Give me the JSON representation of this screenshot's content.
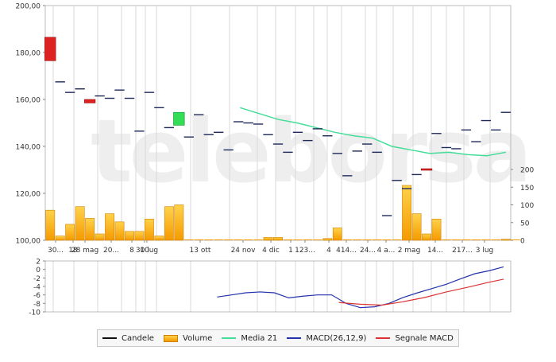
{
  "colors": {
    "candle_up": "#33dd55",
    "candle_down": "#dd2222",
    "doji": "#1f2a5a",
    "volume_fill_top": "#ffd24a",
    "volume_fill_bottom": "#f59a00",
    "media21": "#44dd99",
    "macd": "#2233aa",
    "signal": "#dd3333",
    "grid": "#d8d8d8",
    "watermark": "#eeeeee"
  },
  "watermark": "teleborsa",
  "legend": [
    {
      "key": "candele",
      "label": "Candele",
      "icon": "black-line"
    },
    {
      "key": "volume",
      "label": "Volume",
      "icon": "orange-box"
    },
    {
      "key": "media21",
      "label": "Media 21",
      "icon": "green-line"
    },
    {
      "key": "macd",
      "label": "MACD(26,12,9)",
      "icon": "blue-line"
    },
    {
      "key": "signal",
      "label": "Segnale MACD",
      "icon": "red-line"
    }
  ],
  "chart_data": [
    {
      "type": "candlestick",
      "y_ticks": [
        "100,00",
        "120,00",
        "140,00",
        "160,00",
        "180,00",
        "200,00"
      ],
      "ylim": [
        100,
        200
      ],
      "volume_y_ticks": [
        "0",
        "50",
        "100",
        "150",
        "200"
      ],
      "volume_ylim": [
        0,
        200
      ],
      "x_labels": [
        "30...",
        "28 mag",
        "18",
        "20...",
        "8",
        "30 lug",
        "10",
        "13 ott",
        "24 nov",
        "4 dic",
        "1",
        "123...",
        "4",
        "414...",
        "24...",
        "4 a...",
        "2 mag",
        "14...",
        "217...",
        "3 lug"
      ],
      "candles": [
        {
          "o": 176.5,
          "c": 186.5,
          "dir": "down"
        },
        {
          "o": 167.5,
          "c": 167.5,
          "dir": "flat"
        },
        {
          "o": 163.0,
          "c": 163.0,
          "dir": "flat"
        },
        {
          "o": 164.5,
          "c": 164.5,
          "dir": "flat"
        },
        {
          "o": 158.5,
          "c": 160.0,
          "dir": "down"
        },
        {
          "o": 161.5,
          "c": 161.5,
          "dir": "flat"
        },
        {
          "o": 160.5,
          "c": 160.5,
          "dir": "flat"
        },
        {
          "o": 164.0,
          "c": 164.0,
          "dir": "flat"
        },
        {
          "o": 160.5,
          "c": 160.5,
          "dir": "flat"
        },
        {
          "o": 146.5,
          "c": 146.5,
          "dir": "flat"
        },
        {
          "o": 163.0,
          "c": 163.0,
          "dir": "flat"
        },
        {
          "o": 156.5,
          "c": 156.5,
          "dir": "flat"
        },
        {
          "o": 148.0,
          "c": 148.0,
          "dir": "flat"
        },
        {
          "o": 149.0,
          "c": 154.5,
          "dir": "up"
        },
        {
          "o": 144.0,
          "c": 144.0,
          "dir": "flat"
        },
        {
          "o": 153.5,
          "c": 153.5,
          "dir": "flat"
        },
        {
          "o": 145.0,
          "c": 145.0,
          "dir": "flat"
        },
        {
          "o": 146.0,
          "c": 146.0,
          "dir": "flat"
        },
        {
          "o": 138.5,
          "c": 138.5,
          "dir": "flat"
        },
        {
          "o": 150.5,
          "c": 150.5,
          "dir": "flat"
        },
        {
          "o": 150.0,
          "c": 150.0,
          "dir": "flat"
        },
        {
          "o": 149.5,
          "c": 149.5,
          "dir": "flat"
        },
        {
          "o": 145.0,
          "c": 145.0,
          "dir": "flat"
        },
        {
          "o": 141.0,
          "c": 141.0,
          "dir": "flat"
        },
        {
          "o": 137.5,
          "c": 137.5,
          "dir": "flat"
        },
        {
          "o": 146.0,
          "c": 146.0,
          "dir": "flat"
        },
        {
          "o": 142.5,
          "c": 142.5,
          "dir": "flat"
        },
        {
          "o": 147.5,
          "c": 147.5,
          "dir": "flat"
        },
        {
          "o": 144.5,
          "c": 144.5,
          "dir": "flat"
        },
        {
          "o": 137.0,
          "c": 137.0,
          "dir": "flat"
        },
        {
          "o": 127.5,
          "c": 127.5,
          "dir": "flat"
        },
        {
          "o": 138.0,
          "c": 138.0,
          "dir": "flat"
        },
        {
          "o": 141.0,
          "c": 141.0,
          "dir": "flat"
        },
        {
          "o": 137.5,
          "c": 137.5,
          "dir": "flat"
        },
        {
          "o": 110.5,
          "c": 110.5,
          "dir": "flat"
        },
        {
          "o": 125.5,
          "c": 125.5,
          "dir": "flat"
        },
        {
          "o": 122.0,
          "c": 122.0,
          "dir": "flat"
        },
        {
          "o": 128.0,
          "c": 128.0,
          "dir": "flat"
        },
        {
          "o": 130.0,
          "c": 130.5,
          "dir": "down"
        },
        {
          "o": 145.5,
          "c": 145.5,
          "dir": "flat"
        },
        {
          "o": 139.5,
          "c": 139.5,
          "dir": "flat"
        },
        {
          "o": 139.0,
          "c": 139.0,
          "dir": "flat"
        },
        {
          "o": 147.0,
          "c": 147.0,
          "dir": "flat"
        },
        {
          "o": 142.0,
          "c": 142.0,
          "dir": "flat"
        },
        {
          "o": 151.0,
          "c": 151.0,
          "dir": "flat"
        },
        {
          "o": 147.0,
          "c": 147.0,
          "dir": "flat"
        },
        {
          "o": 154.5,
          "c": 154.5,
          "dir": "flat"
        }
      ],
      "volume": [
        85,
        12,
        45,
        95,
        62,
        18,
        75,
        52,
        25,
        25,
        60,
        12,
        95,
        100,
        0,
        0,
        0,
        0,
        0,
        0,
        0,
        0,
        8,
        8,
        0,
        0,
        0,
        0,
        5,
        35,
        0,
        0,
        0,
        0,
        0,
        0,
        155,
        75,
        18,
        60,
        0,
        0,
        0,
        0,
        0,
        0,
        3,
        0
      ],
      "media21": [
        {
          "i": 20,
          "v": 156.5
        },
        {
          "i": 22,
          "v": 154.0
        },
        {
          "i": 24,
          "v": 151.5
        },
        {
          "i": 26,
          "v": 150.0
        },
        {
          "i": 28,
          "v": 148.0
        },
        {
          "i": 30,
          "v": 146.0
        },
        {
          "i": 32,
          "v": 144.5
        },
        {
          "i": 34,
          "v": 143.5
        },
        {
          "i": 36,
          "v": 140.0
        },
        {
          "i": 38,
          "v": 138.5
        },
        {
          "i": 40,
          "v": 137.0
        },
        {
          "i": 42,
          "v": 137.5
        },
        {
          "i": 44,
          "v": 136.5
        },
        {
          "i": 46,
          "v": 136.0
        },
        {
          "i": 48,
          "v": 137.5
        }
      ]
    },
    {
      "type": "line",
      "y_ticks": [
        "2",
        "0",
        "-2",
        "-4",
        "-6",
        "-8",
        "-10"
      ],
      "ylim": [
        -10,
        2
      ],
      "series": [
        {
          "name": "MACD(26,12,9)",
          "points": [
            {
              "i": 24,
              "v": -6.5
            },
            {
              "i": 26,
              "v": -6.0
            },
            {
              "i": 28,
              "v": -5.5
            },
            {
              "i": 30,
              "v": -5.3
            },
            {
              "i": 32,
              "v": -5.5
            },
            {
              "i": 34,
              "v": -6.7
            },
            {
              "i": 36,
              "v": -6.3
            },
            {
              "i": 38,
              "v": -6.0
            },
            {
              "i": 40,
              "v": -6.0
            },
            {
              "i": 42,
              "v": -8.0
            },
            {
              "i": 44,
              "v": -9.0
            },
            {
              "i": 46,
              "v": -8.8
            },
            {
              "i": 48,
              "v": -8.0
            },
            {
              "i": 50,
              "v": -6.6
            },
            {
              "i": 52,
              "v": -5.5
            },
            {
              "i": 54,
              "v": -4.5
            },
            {
              "i": 56,
              "v": -3.5
            },
            {
              "i": 58,
              "v": -2.2
            },
            {
              "i": 60,
              "v": -1.0
            },
            {
              "i": 62,
              "v": -0.3
            },
            {
              "i": 64,
              "v": 0.6
            }
          ]
        },
        {
          "name": "Segnale MACD",
          "points": [
            {
              "i": 41,
              "v": -7.8
            },
            {
              "i": 44,
              "v": -8.2
            },
            {
              "i": 47,
              "v": -8.4
            },
            {
              "i": 50,
              "v": -7.6
            },
            {
              "i": 53,
              "v": -6.6
            },
            {
              "i": 56,
              "v": -5.3
            },
            {
              "i": 59,
              "v": -4.2
            },
            {
              "i": 62,
              "v": -3.0
            },
            {
              "i": 64,
              "v": -2.3
            }
          ]
        }
      ]
    }
  ]
}
